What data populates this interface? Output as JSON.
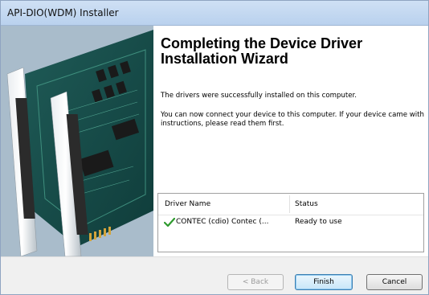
{
  "window": {
    "title": "API-DIO(WDM) Installer"
  },
  "wizard": {
    "heading_line1": "Completing the Device Driver",
    "heading_line2": "Installation Wizard",
    "message1": "The drivers were successfully installed on this computer.",
    "message2": "You can now connect your device to this computer. If your device came with instructions, please read them first."
  },
  "driver_table": {
    "columns": [
      "Driver Name",
      "Status"
    ],
    "rows": [
      {
        "name": "CONTEC (cdio) Contec  (...",
        "status": "Ready to use",
        "icon": "check-icon"
      }
    ]
  },
  "buttons": {
    "back": "< Back",
    "finish": "Finish",
    "cancel": "Cancel"
  },
  "colors": {
    "check": "#2e9a2e",
    "titlebar": "#c5daf2"
  }
}
